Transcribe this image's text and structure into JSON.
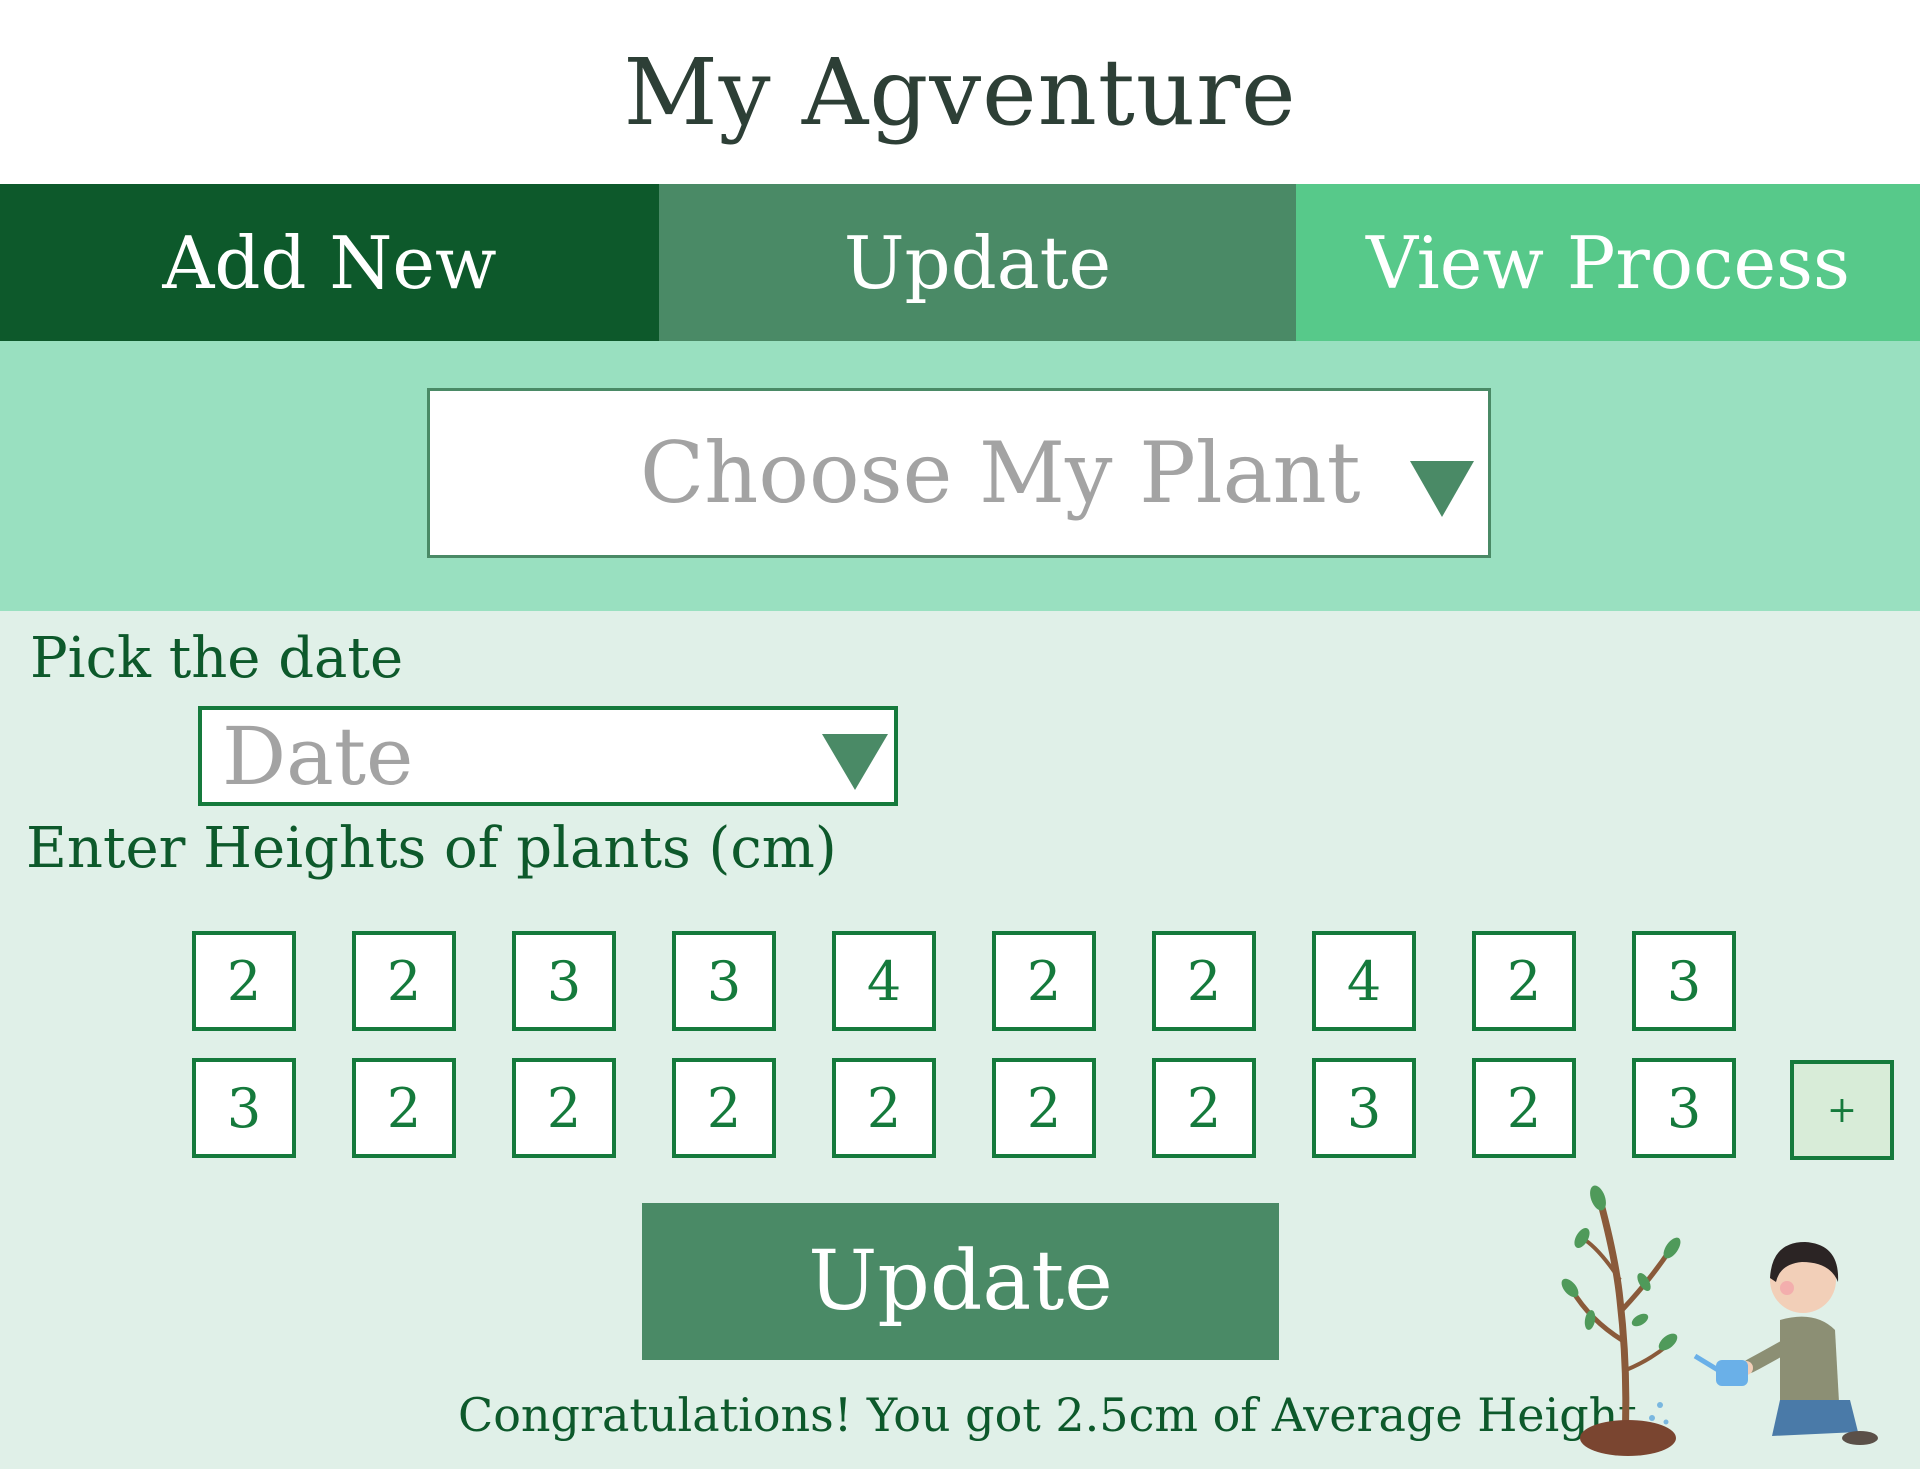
{
  "app": {
    "title": "My Agventure"
  },
  "tabs": [
    {
      "label": "Add New"
    },
    {
      "label": "Update"
    },
    {
      "label": "View Process"
    }
  ],
  "plant_select": {
    "placeholder": "Choose My Plant"
  },
  "date_section": {
    "label": "Pick the date",
    "placeholder": "Date"
  },
  "heights": {
    "label": "Enter Heights of plants (cm)",
    "row1": [
      "2",
      "2",
      "3",
      "3",
      "4",
      "2",
      "2",
      "4",
      "2",
      "3"
    ],
    "row2": [
      "3",
      "2",
      "2",
      "2",
      "2",
      "2",
      "2",
      "3",
      "2",
      "3"
    ],
    "add_label": "+"
  },
  "update_button": {
    "label": "Update"
  },
  "result": {
    "message": "Congratulations! You got 2.5cm of Average Height"
  },
  "colors": {
    "tab_add": "#0d592b",
    "tab_update": "#4a8a66",
    "tab_view": "#57c98a",
    "band": "#99e0c0",
    "form_bg": "#e0f0e8",
    "accent_green": "#157a3c"
  },
  "icons": {
    "dropdown": "triangle-down-icon",
    "illustration": "child-watering-tree-illustration"
  }
}
